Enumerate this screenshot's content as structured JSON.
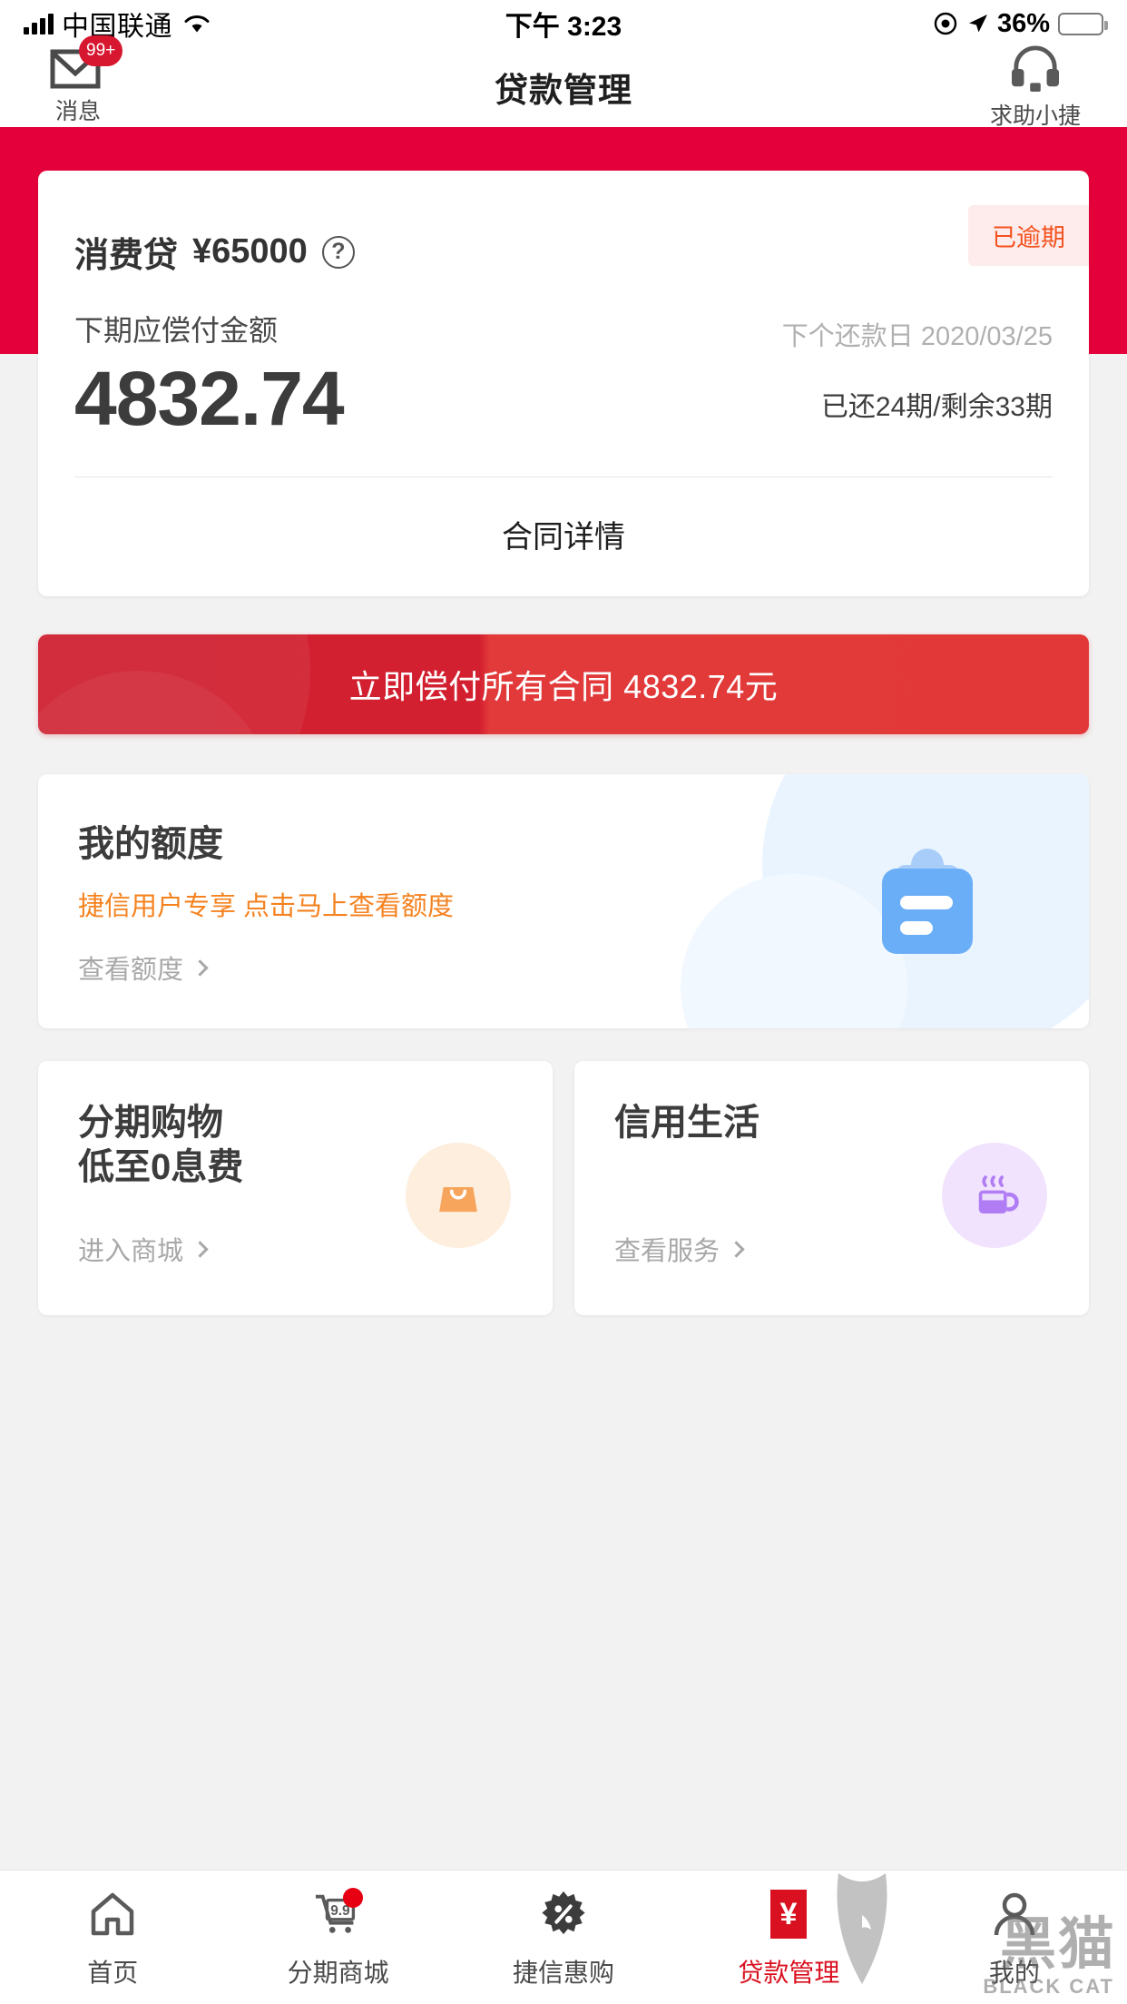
{
  "status_bar": {
    "carrier": "中国联通",
    "time": "下午 3:23",
    "battery_percent": "36%",
    "signal_icon": "signal-bars-icon",
    "wifi_icon": "wifi-icon",
    "lock_icon": "rotation-lock-icon",
    "location_icon": "location-arrow-icon",
    "battery_icon": "battery-icon"
  },
  "nav": {
    "title": "贷款管理",
    "messages_label": "消息",
    "messages_badge": "99+",
    "messages_icon": "mail-icon",
    "help_label": "求助小捷",
    "help_icon": "headset-icon"
  },
  "loan_card": {
    "product_name": "消费贷",
    "product_amount": "¥65000",
    "help_icon": "question-mark-icon",
    "status_badge": "已逾期",
    "next_payment_label": "下期应偿付金额",
    "next_payment_amount": "4832.74",
    "next_date_label": "下个还款日",
    "next_date_value": "2020/03/25",
    "terms": "已还24期/剩余33期",
    "details_link": "合同详情"
  },
  "cta": {
    "label": "立即偿付所有合同 4832.74元"
  },
  "quota_card": {
    "title": "我的额度",
    "subtitle": "捷信用户专享 点击马上查看额度",
    "link": "查看额度",
    "icon": "clipboard-icon"
  },
  "mini_cards": [
    {
      "title_line1": "分期购物",
      "title_line2": "低至0息费",
      "link": "进入商城",
      "icon": "shopping-bag-icon"
    },
    {
      "title_line1": "信用生活",
      "title_line2": "",
      "link": "查看服务",
      "icon": "coffee-cup-icon"
    }
  ],
  "tabbar": [
    {
      "label": "首页",
      "icon": "home-icon",
      "active": false,
      "badge": false
    },
    {
      "label": "分期商城",
      "icon": "shopping-cart-icon",
      "active": false,
      "badge": true
    },
    {
      "label": "捷信惠购",
      "icon": "discount-badge-icon",
      "active": false,
      "badge": false
    },
    {
      "label": "贷款管理",
      "icon": "yen-tag-icon",
      "active": true,
      "badge": false
    },
    {
      "label": "我的",
      "icon": "person-icon",
      "active": false,
      "badge": false
    }
  ],
  "watermark": {
    "cjk": "黑猫",
    "latin": "BLACK CAT"
  },
  "colors": {
    "brand_red": "#e4003a",
    "cta_red": "#d32030",
    "accent_orange": "#f5821f",
    "overdue_text": "#f4511e",
    "overdue_bg": "#fdeceb",
    "active_tab": "#d9101f",
    "muted_text": "#a8a8a8"
  }
}
